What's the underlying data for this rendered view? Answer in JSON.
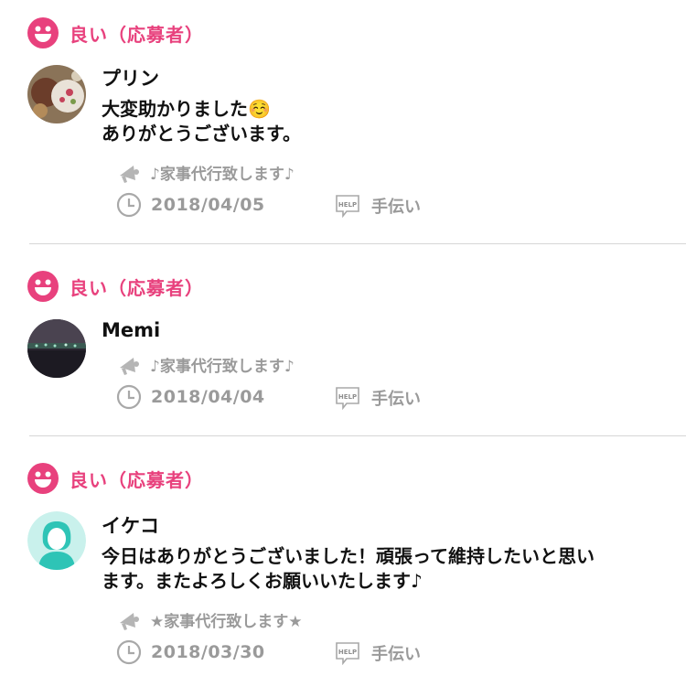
{
  "colors": {
    "accent": "#e8417d",
    "meta_gray": "#9a9a9a",
    "divider": "#d6d6d6",
    "avatar_teal": "#2ec4b6"
  },
  "icons": {
    "rating": "smiley-face-icon",
    "job": "megaphone-icon",
    "date": "clock-icon",
    "category": "help-tag-icon"
  },
  "reviews": [
    {
      "rating_label": "良い（応募者）",
      "name": "プリン",
      "comment_lines": [
        "大変助かりました☺️",
        "ありがとうございます。"
      ],
      "job_title": "♪家事代行致します♪",
      "date": "2018/04/05",
      "category": "手伝い"
    },
    {
      "rating_label": "良い（応募者）",
      "name": "Memi",
      "comment_lines": [],
      "job_title": "♪家事代行致します♪",
      "date": "2018/04/04",
      "category": "手伝い"
    },
    {
      "rating_label": "良い（応募者）",
      "name": "イケコ",
      "comment_lines": [
        "今日はありがとうございました！頑張って維持したいと思い",
        "ます。またよろしくお願いいたします♪"
      ],
      "job_title": "★家事代行致します★",
      "date": "2018/03/30",
      "category": "手伝い"
    }
  ]
}
